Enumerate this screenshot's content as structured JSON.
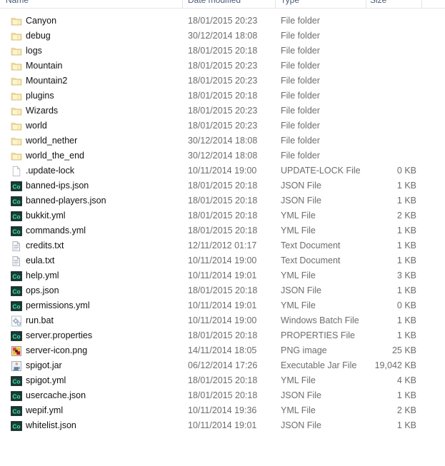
{
  "window": {
    "view": "details",
    "accent_header_color": "#4a5a7a",
    "text_color": "#111111",
    "secondary_text_color": "#6d6d6d"
  },
  "columns": {
    "name": "Name",
    "date_modified": "Date modified",
    "type": "Type",
    "size": "Size"
  },
  "rows": [
    {
      "name": "Canyon",
      "date": "18/01/2015 20:23",
      "type": "File folder",
      "size": "",
      "icon": "folder-icon"
    },
    {
      "name": "debug",
      "date": "30/12/2014 18:08",
      "type": "File folder",
      "size": "",
      "icon": "folder-icon"
    },
    {
      "name": "logs",
      "date": "18/01/2015 20:18",
      "type": "File folder",
      "size": "",
      "icon": "folder-icon"
    },
    {
      "name": "Mountain",
      "date": "18/01/2015 20:23",
      "type": "File folder",
      "size": "",
      "icon": "folder-icon"
    },
    {
      "name": "Mountain2",
      "date": "18/01/2015 20:23",
      "type": "File folder",
      "size": "",
      "icon": "folder-icon"
    },
    {
      "name": "plugins",
      "date": "18/01/2015 20:18",
      "type": "File folder",
      "size": "",
      "icon": "folder-icon"
    },
    {
      "name": "Wizards",
      "date": "18/01/2015 20:23",
      "type": "File folder",
      "size": "",
      "icon": "folder-icon"
    },
    {
      "name": "world",
      "date": "18/01/2015 20:23",
      "type": "File folder",
      "size": "",
      "icon": "folder-icon"
    },
    {
      "name": "world_nether",
      "date": "30/12/2014 18:08",
      "type": "File folder",
      "size": "",
      "icon": "folder-icon"
    },
    {
      "name": "world_the_end",
      "date": "30/12/2014 18:08",
      "type": "File folder",
      "size": "",
      "icon": "folder-icon"
    },
    {
      "name": ".update-lock",
      "date": "10/11/2014 19:00",
      "type": "UPDATE-LOCK File",
      "size": "0 KB",
      "icon": "blank-document-icon"
    },
    {
      "name": "banned-ips.json",
      "date": "18/01/2015 20:18",
      "type": "JSON File",
      "size": "1 KB",
      "icon": "code-editor-icon"
    },
    {
      "name": "banned-players.json",
      "date": "18/01/2015 20:18",
      "type": "JSON File",
      "size": "1 KB",
      "icon": "code-editor-icon"
    },
    {
      "name": "bukkit.yml",
      "date": "18/01/2015 20:18",
      "type": "YML File",
      "size": "2 KB",
      "icon": "code-editor-icon"
    },
    {
      "name": "commands.yml",
      "date": "18/01/2015 20:18",
      "type": "YML File",
      "size": "1 KB",
      "icon": "code-editor-icon"
    },
    {
      "name": "credits.txt",
      "date": "12/11/2012 01:17",
      "type": "Text Document",
      "size": "1 KB",
      "icon": "text-document-icon"
    },
    {
      "name": "eula.txt",
      "date": "10/11/2014 19:00",
      "type": "Text Document",
      "size": "1 KB",
      "icon": "text-document-icon"
    },
    {
      "name": "help.yml",
      "date": "10/11/2014 19:01",
      "type": "YML File",
      "size": "3 KB",
      "icon": "code-editor-icon"
    },
    {
      "name": "ops.json",
      "date": "18/01/2015 20:18",
      "type": "JSON File",
      "size": "1 KB",
      "icon": "code-editor-icon"
    },
    {
      "name": "permissions.yml",
      "date": "10/11/2014 19:01",
      "type": "YML File",
      "size": "0 KB",
      "icon": "code-editor-icon"
    },
    {
      "name": "run.bat",
      "date": "10/11/2014 19:00",
      "type": "Windows Batch File",
      "size": "1 KB",
      "icon": "batch-gear-icon"
    },
    {
      "name": "server.properties",
      "date": "18/01/2015 20:18",
      "type": "PROPERTIES File",
      "size": "1 KB",
      "icon": "code-editor-icon"
    },
    {
      "name": "server-icon.png",
      "date": "14/11/2014 18:05",
      "type": "PNG image",
      "size": "25 KB",
      "icon": "png-image-icon"
    },
    {
      "name": "spigot.jar",
      "date": "06/12/2014 17:26",
      "type": "Executable Jar File",
      "size": "19,042 KB",
      "icon": "java-jar-icon"
    },
    {
      "name": "spigot.yml",
      "date": "18/01/2015 20:18",
      "type": "YML File",
      "size": "4 KB",
      "icon": "code-editor-icon"
    },
    {
      "name": "usercache.json",
      "date": "18/01/2015 20:18",
      "type": "JSON File",
      "size": "1 KB",
      "icon": "code-editor-icon"
    },
    {
      "name": "wepif.yml",
      "date": "10/11/2014 19:36",
      "type": "YML File",
      "size": "2 KB",
      "icon": "code-editor-icon"
    },
    {
      "name": "whitelist.json",
      "date": "10/11/2014 19:01",
      "type": "JSON File",
      "size": "1 KB",
      "icon": "code-editor-icon"
    }
  ]
}
